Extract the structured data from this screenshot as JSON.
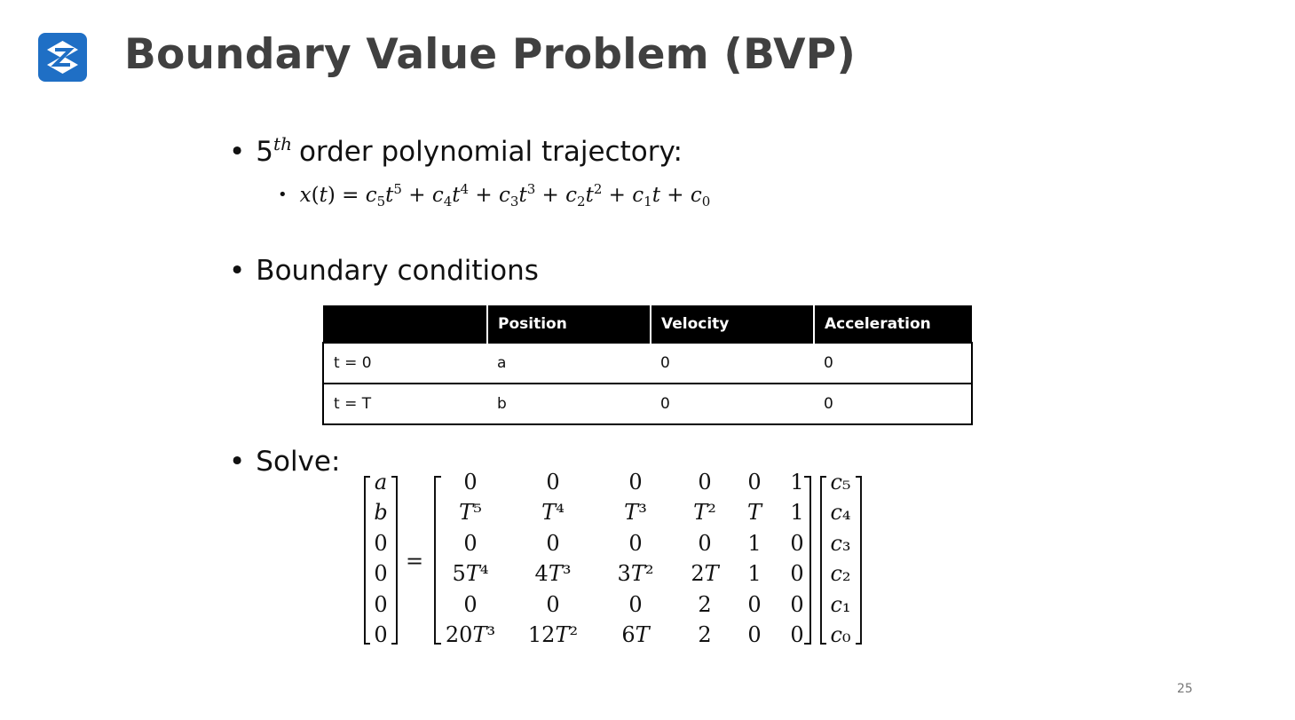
{
  "slide": {
    "title": "Boundary Value Problem (BVP)",
    "page_number": "25",
    "logo_color": "#1f6fc5"
  },
  "bullets": {
    "bullet_symbol": "•",
    "polynomial": {
      "prefix": "5",
      "superscript": "th",
      "text": "order polynomial trajectory:"
    },
    "equation": "x(t) = c5t5 + c4t4 + c3t3 + c2t2 + c1t + c0",
    "boundary": "Boundary conditions",
    "solve": "Solve:"
  },
  "table": {
    "headers": [
      "",
      "Position",
      "Velocity",
      "Acceleration"
    ],
    "rows": [
      [
        "t = 0",
        "a",
        "0",
        "0"
      ],
      [
        "t = T",
        "b",
        "0",
        "0"
      ]
    ]
  },
  "system": {
    "lhs": [
      "a",
      "b",
      "0",
      "0",
      "0",
      "0"
    ],
    "equals": "=",
    "matrix": [
      [
        "0",
        "0",
        "0",
        "0",
        "0",
        "1"
      ],
      [
        "T⁵",
        "T⁴",
        "T³",
        "T²",
        "T",
        "1"
      ],
      [
        "0",
        "0",
        "0",
        "0",
        "1",
        "0"
      ],
      [
        "5T⁴",
        "4T³",
        "3T²",
        "2T",
        "1",
        "0"
      ],
      [
        "0",
        "0",
        "0",
        "2",
        "0",
        "0"
      ],
      [
        "20T³",
        "12T²",
        "6T",
        "2",
        "0",
        "0"
      ]
    ],
    "unknowns": [
      "c₅",
      "c₄",
      "c₃",
      "c₂",
      "c₁",
      "c₀"
    ]
  }
}
